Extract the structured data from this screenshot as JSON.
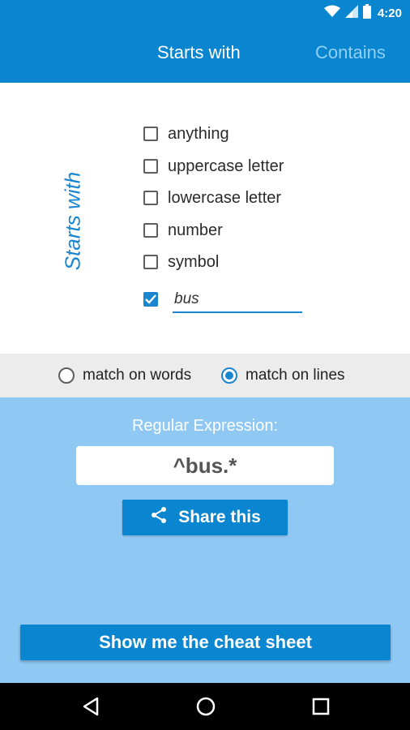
{
  "status": {
    "time": "4:20",
    "icons": [
      "wifi-icon",
      "signal-icon",
      "battery-icon"
    ]
  },
  "tabs": [
    {
      "label": "Starts with",
      "active": true
    },
    {
      "label": "Contains",
      "active": false
    }
  ],
  "section": {
    "title": "Starts with"
  },
  "options": [
    {
      "label": "anything",
      "checked": false
    },
    {
      "label": "uppercase letter",
      "checked": false
    },
    {
      "label": "lowercase letter",
      "checked": false
    },
    {
      "label": "number",
      "checked": false
    },
    {
      "label": "symbol",
      "checked": false
    }
  ],
  "custom": {
    "checked": true,
    "value": "bus"
  },
  "match": {
    "words_label": "match on words",
    "lines_label": "match on lines",
    "selected": "lines"
  },
  "regex": {
    "label": "Regular Expression:",
    "value": "^bus.*"
  },
  "buttons": {
    "share": "Share this",
    "cheat_sheet": "Show me the cheat sheet"
  },
  "navigation": {
    "icons": [
      "back-icon",
      "home-icon",
      "recents-icon"
    ]
  },
  "colors": {
    "primary": "#0a86d0",
    "accent": "#1a86cf",
    "light_blue": "#8fc8f3"
  }
}
